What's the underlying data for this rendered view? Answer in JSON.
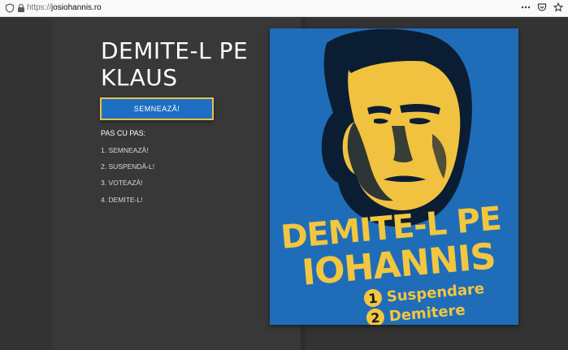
{
  "browser": {
    "url_protocol": "https://",
    "url_host": "josiohannis.ro"
  },
  "hero": {
    "headline": "DEMITE-L PE KLAUS",
    "sign_button": "SEMNEAZĂ!"
  },
  "steps": {
    "title": "PAS CU PAS:",
    "items": [
      "1. SEMNEAZĂ!",
      "2. SUSPENDĂ-L!",
      "3. VOTEAZĂ!",
      "4. DEMITE-L!"
    ]
  },
  "poster": {
    "line1": "DEMITE-L PE",
    "line2": "IOHANNIS",
    "items": [
      {
        "num": "1",
        "label": "Suspendare"
      },
      {
        "num": "2",
        "label": "Demitere"
      }
    ]
  },
  "colors": {
    "page_bg": "#333333",
    "button_blue": "#1e6fc4",
    "accent_yellow": "#f3c63f",
    "poster_blue": "#1f6db8"
  }
}
